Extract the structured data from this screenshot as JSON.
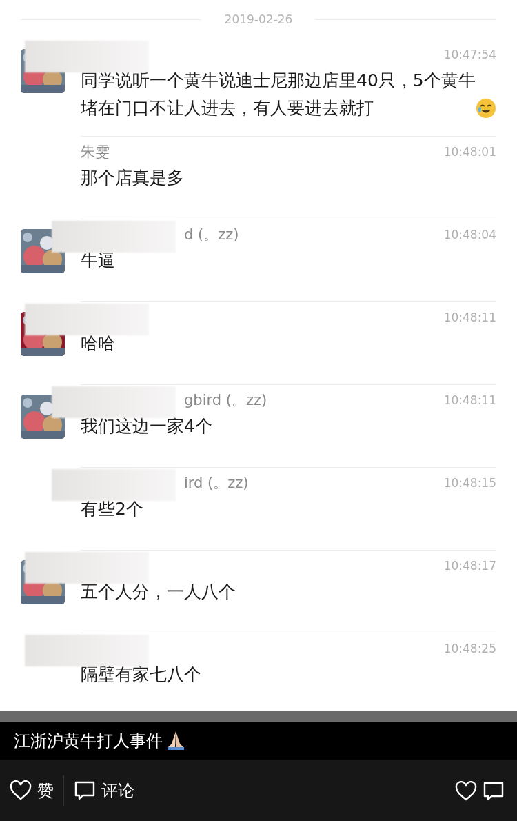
{
  "date_separator": "2019-02-26",
  "messages": [
    {
      "redacted": true,
      "avatar": true,
      "time": "10:47:54",
      "text": "同学说听一个黄牛说迪士尼那边店里40只，5个黄牛堵在门口不让人进去，有人要进去就打",
      "emoji": true
    },
    {
      "redacted": false,
      "avatar": false,
      "name": "朱雯",
      "time": "10:48:01",
      "text": "那个店真是多"
    },
    {
      "redacted": true,
      "avatar": true,
      "name": "d (。zz)",
      "time": "10:48:04",
      "text": "牛逼"
    },
    {
      "redacted": true,
      "avatar": true,
      "time": "10:48:11",
      "text": "哈哈"
    },
    {
      "redacted": true,
      "avatar": true,
      "name": "gbird (。zz)",
      "time": "10:48:11",
      "text": "我们这边一家4个"
    },
    {
      "redacted": true,
      "avatar": false,
      "name": "ird (。zz)",
      "time": "10:48:15",
      "text": "有些2个"
    },
    {
      "redacted": true,
      "avatar": true,
      "time": "10:48:17",
      "text": "五个人分，一人八个"
    },
    {
      "redacted": true,
      "avatar": false,
      "time": "10:48:25",
      "text": "隔壁有家七八个"
    }
  ],
  "caption": {
    "text": "江浙沪黄牛打人事件",
    "emoji": true
  },
  "actions": [
    {
      "label": "赞",
      "kind": "like"
    },
    {
      "label": "评论",
      "kind": "comment"
    }
  ],
  "right_actions": [
    {
      "kind": "like"
    },
    {
      "kind": "comment"
    }
  ]
}
